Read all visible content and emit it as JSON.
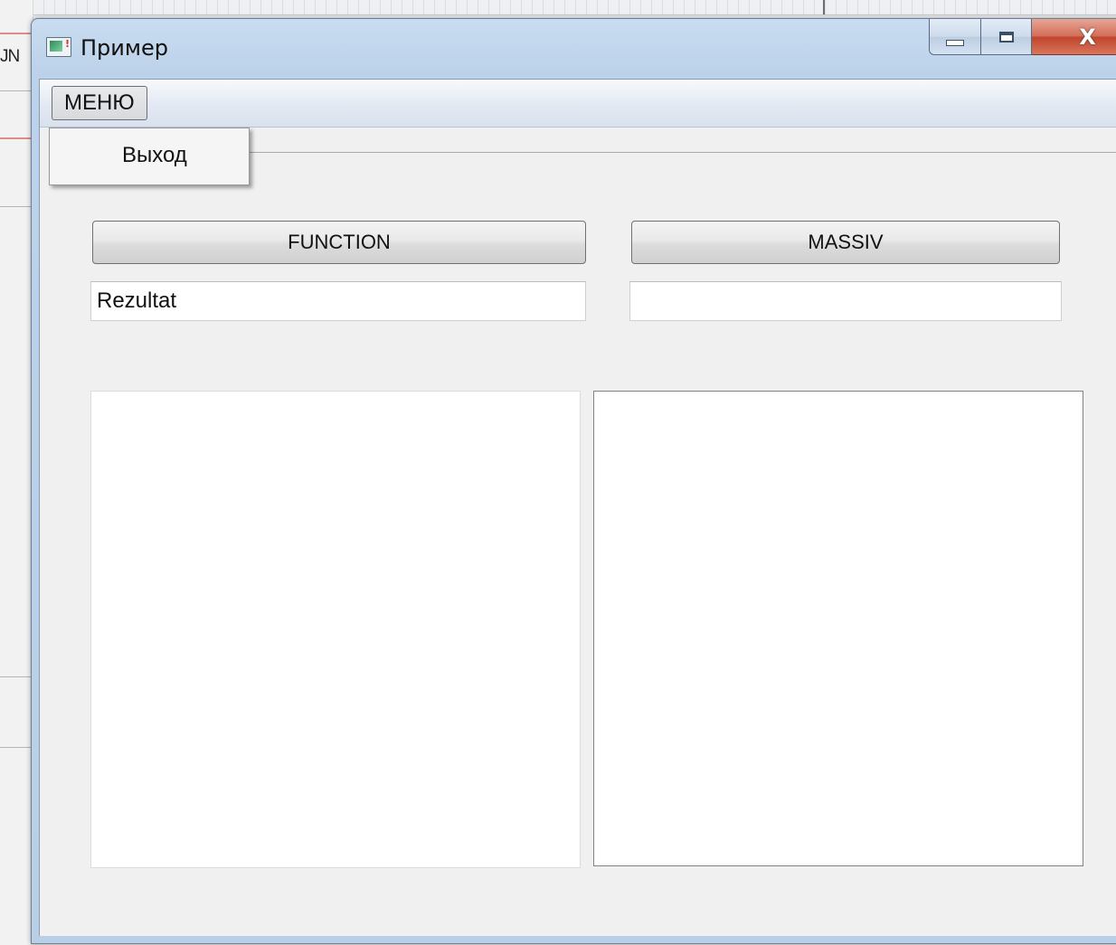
{
  "background": {
    "side_text": "JN"
  },
  "window": {
    "title": "Пример",
    "close_glyph": "X"
  },
  "menubar": {
    "menu_label": "МЕНЮ",
    "dropdown_items": [
      "Выход"
    ]
  },
  "buttons": {
    "function_label": "FUNCTION",
    "massiv_label": "MASSIV"
  },
  "fields": {
    "result_value": "Rezultat",
    "massiv_value": ""
  },
  "colors": {
    "titlebar": "#bcd2ea",
    "client_bg": "#f0f0f0",
    "close_button": "#c0452c"
  }
}
